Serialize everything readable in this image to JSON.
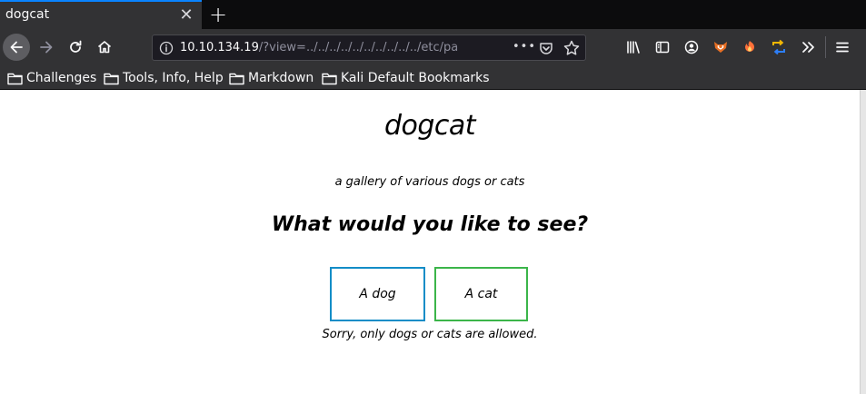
{
  "browser": {
    "tab_title": "dogcat",
    "tab_close": "✕",
    "new_tab": "+",
    "url_host": "10.10.134.19",
    "url_path": "/?view=../../../../../../../../../../etc/pa",
    "url_more": "•••",
    "accent_color": "#0a84ff"
  },
  "bookmarks": [
    {
      "label": "Challenges"
    },
    {
      "label": "Tools, Info, Help"
    },
    {
      "label": "Markdown"
    },
    {
      "label": "Kali Default Bookmarks"
    }
  ],
  "toolbar_icons": [
    "library-icon",
    "sidebar-icon",
    "account-icon",
    "fox-extension-icon",
    "firefox-extension-icon",
    "switch-extension-icon",
    "overflow-icon",
    "menu-icon"
  ],
  "page": {
    "title": "dogcat",
    "subtitle": "a gallery of various dogs or cats",
    "question": "What would you like to see?",
    "dog_button": "A dog",
    "cat_button": "A cat",
    "message": "Sorry, only dogs or cats are allowed.",
    "dog_border_color": "#138dc7",
    "cat_border_color": "#3bb54a"
  }
}
